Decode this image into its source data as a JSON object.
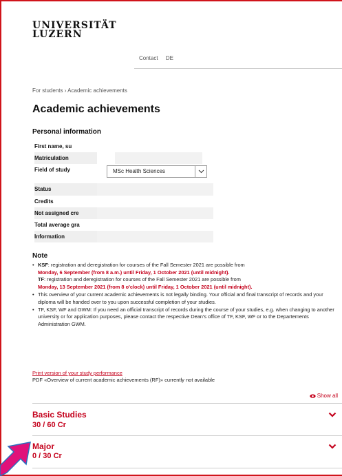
{
  "logo": {
    "line1": "UNIVERSITÄT",
    "line2": "LUZERN"
  },
  "topnav": {
    "contact": "Contact",
    "lang": "DE"
  },
  "breadcrumb": {
    "parent": "For students",
    "separator": "›",
    "current": "Academic achievements"
  },
  "page_title": "Academic achievements",
  "personal_info": {
    "title": "Personal information",
    "rows": [
      {
        "label": "First name, su"
      },
      {
        "label": "Matriculation"
      },
      {
        "label": "Field of study",
        "select_value": "MSc Health Sciences"
      },
      {
        "label": "Status"
      },
      {
        "label": "Credits"
      },
      {
        "label": "Not assigned cre"
      },
      {
        "label": "Total average gra"
      },
      {
        "label": "Information"
      }
    ]
  },
  "note": {
    "title": "Note",
    "ksf_label": "KSF",
    "ksf_text": ": registration and deregistration for courses of the Fall Semester 2021 are possible from",
    "ksf_dates": "Monday, 6 September (from 8 a.m.) until Friday, 1 October 2021 (until midnight).",
    "tf_label": "TF",
    "tf_text": ": registration and deregistration for courses of the Fall Semester 2021 are possible from",
    "tf_dates": "Monday, 13 September 2021 (from 8 o'clock) until Friday, 1 October 2021 (until midnight).",
    "bullet2": "This overview of your current academic achievements is not legally binding. Your official and final transcript of records and your diploma will be handed over to you upon successful completion of your studies.",
    "bullet3": "TF, KSF, WF and GWM: If you need an official transcript of records during the course of your studies, e.g. when changing to another university or for application purposes, please contact the respective Dean's office of TF, KSF, WF or to the Departements Administration GWM."
  },
  "print_link": "Print version of your study performance",
  "pdf_note": "PDF «Overview of current academic achievements (RF)» currently not available",
  "show_all": "Show all",
  "accordion": [
    {
      "title": "Basic Studies",
      "credits": "30 / 60 Cr"
    },
    {
      "title": "Major",
      "credits": "0 / 30 Cr"
    }
  ],
  "colors": {
    "accent": "#c4001b",
    "frame": "#d0141b",
    "arrow": "#e0117a"
  }
}
